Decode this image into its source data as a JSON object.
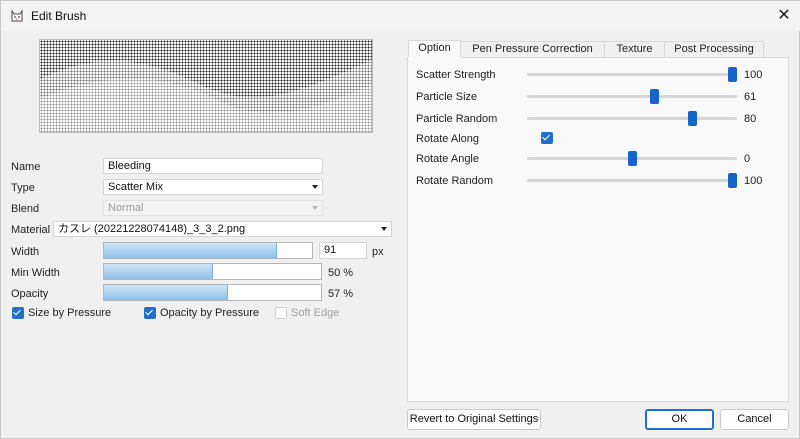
{
  "window": {
    "title": "Edit Brush",
    "app_icon": "cat-icon",
    "close_icon": "close-icon",
    "close_glyph": "✕"
  },
  "brush": {
    "name_label": "Name",
    "name_value": "Bleeding",
    "type_label": "Type",
    "type_value": "Scatter Mix",
    "blend_label": "Blend",
    "blend_value": "Normal",
    "material_label": "Material",
    "material_value": "カスレ (20221228074148)_3_3_2.png",
    "width_label": "Width",
    "width_value": "91",
    "width_unit": "px",
    "width_fraction": 0.83,
    "min_width_label": "Min Width",
    "min_width_value": "50 %",
    "min_width_fraction": 0.5,
    "opacity_label": "Opacity",
    "opacity_value": "57 %",
    "opacity_fraction": 0.57,
    "size_by_pressure_label": "Size by Pressure",
    "size_by_pressure_checked": true,
    "opacity_by_pressure_label": "Opacity by Pressure",
    "opacity_by_pressure_checked": true,
    "soft_edge_label": "Soft Edge",
    "soft_edge_checked": false
  },
  "tabs": [
    {
      "label": "Option",
      "active": true
    },
    {
      "label": "Pen Pressure Correction",
      "active": false
    },
    {
      "label": "Texture",
      "active": false
    },
    {
      "label": "Post Processing",
      "active": false
    }
  ],
  "option": {
    "scatter_strength": {
      "label": "Scatter Strength",
      "value": "100",
      "fraction": 1.0
    },
    "particle_size": {
      "label": "Particle Size",
      "value": "61",
      "fraction": 0.61
    },
    "particle_random": {
      "label": "Particle Random",
      "value": "80",
      "fraction": 0.8
    },
    "rotate_along": {
      "label": "Rotate Along",
      "checked": true
    },
    "rotate_angle": {
      "label": "Rotate Angle",
      "value": "0",
      "fraction": 0.5
    },
    "rotate_random": {
      "label": "Rotate Random",
      "value": "100",
      "fraction": 1.0
    }
  },
  "buttons": {
    "revert": "Revert to Original Settings",
    "ok": "OK",
    "cancel": "Cancel"
  },
  "colors": {
    "accent": "#1565c8",
    "checkbox": "#1f6fcb",
    "bar_fill": "#8fc0e8"
  }
}
